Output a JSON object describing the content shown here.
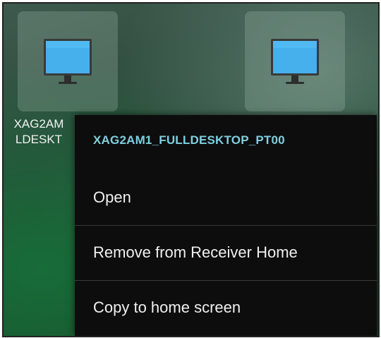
{
  "desktop": {
    "tiles": [
      {
        "label": "XAG2AM\nLDESKT",
        "icon": "monitor-icon"
      },
      {
        "label": "",
        "icon": "monitor-icon"
      }
    ]
  },
  "context_menu": {
    "title": "XAG2AM1_FULLDESKTOP_PT00",
    "items": [
      {
        "label": "Open"
      },
      {
        "label": "Remove from Receiver Home"
      },
      {
        "label": "Copy to home screen"
      }
    ]
  },
  "colors": {
    "menu_background": "#0d0d0d",
    "menu_title": "#7fd0e0",
    "menu_text": "#f0f0f0",
    "monitor_screen": "#46b0ec"
  }
}
